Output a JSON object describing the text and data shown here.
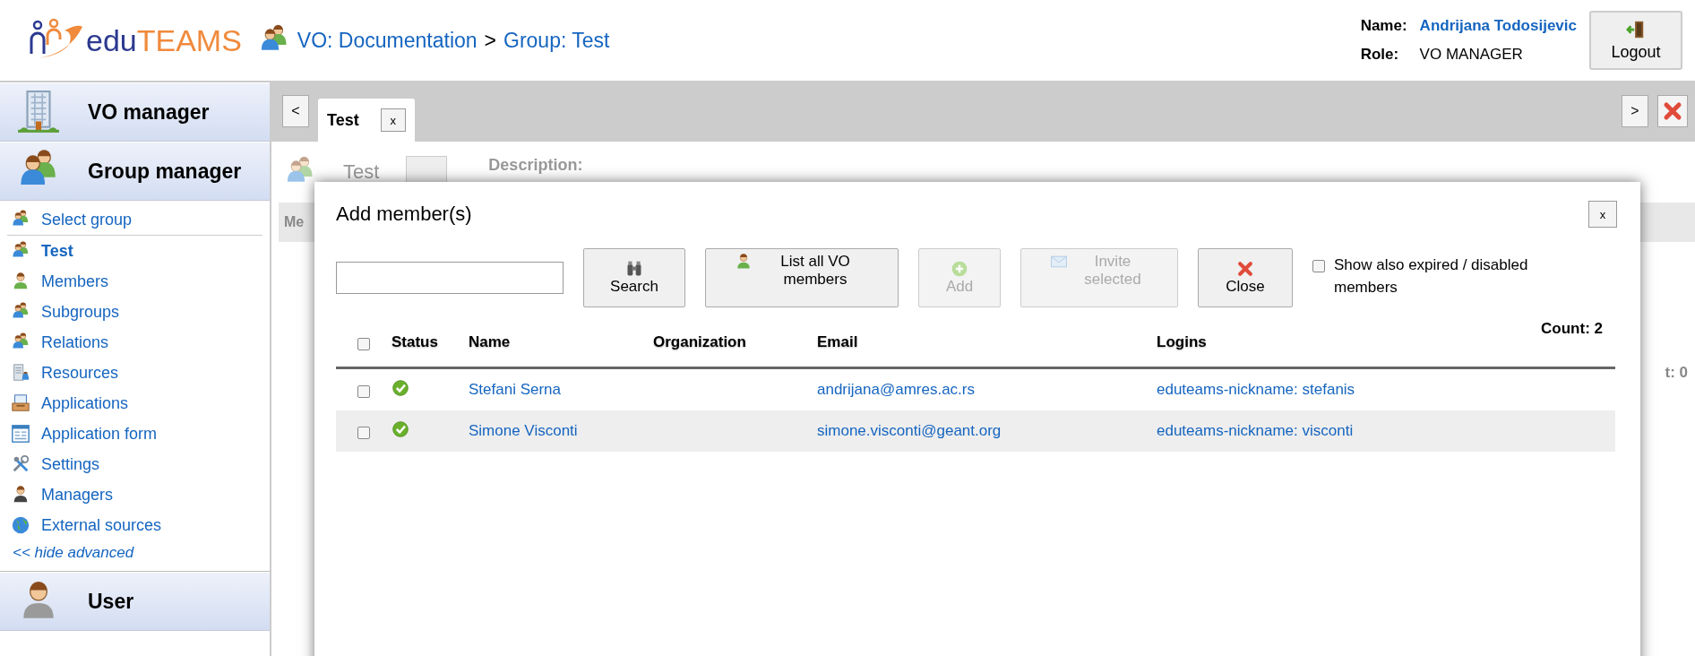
{
  "header": {
    "logo": {
      "part1": "edu",
      "part2": "TEAMS"
    },
    "breadcrumb": [
      {
        "kind": "link",
        "text": "VO: Documentation"
      },
      {
        "kind": "separator",
        "text": ">"
      },
      {
        "kind": "link",
        "text": "Group: Test"
      }
    ],
    "user": {
      "name_label": "Name:",
      "name": "Andrijana Todosijevic",
      "role_label": "Role:",
      "role": "VO MANAGER"
    },
    "logout": "Logout"
  },
  "sidebar": {
    "sections": [
      {
        "title": "VO manager"
      },
      {
        "title": "Group manager",
        "items": [
          {
            "label": "Select group",
            "selected": false
          },
          {
            "label": "Test",
            "selected": true
          },
          {
            "label": "Members",
            "selected": false
          },
          {
            "label": "Subgroups",
            "selected": false
          },
          {
            "label": "Relations",
            "selected": false
          },
          {
            "label": "Resources",
            "selected": false
          },
          {
            "label": "Applications",
            "selected": false
          },
          {
            "label": "Application form",
            "selected": false
          },
          {
            "label": "Settings",
            "selected": false
          },
          {
            "label": "Managers",
            "selected": false
          },
          {
            "label": "External sources",
            "selected": false
          }
        ],
        "toggle": "<< hide advanced"
      },
      {
        "title": "User"
      }
    ]
  },
  "tabbar": {
    "prev": "<",
    "next": ">",
    "tabs": [
      {
        "label": "Test",
        "close": "x",
        "selected": true
      }
    ]
  },
  "background": {
    "title": "Test",
    "description_label": "Description:",
    "subtab": "Me",
    "count": "t: 0"
  },
  "dialog": {
    "title": "Add member(s)",
    "close": "x",
    "buttons": [
      {
        "label": "Search",
        "disabled": false
      },
      {
        "label": "List all VO members",
        "disabled": false
      },
      {
        "label": "Add",
        "disabled": true
      },
      {
        "label": "Invite selected",
        "disabled": true
      },
      {
        "label": "Close",
        "disabled": false
      }
    ],
    "option": {
      "label": "Show also expired / disabled members",
      "checked": false
    },
    "table": {
      "select_all": false,
      "columns": [
        "Status",
        "Name",
        "Organization",
        "Email",
        "Logins"
      ],
      "count": "Count: 2",
      "rows": [
        {
          "checked": false,
          "valid": true,
          "name": "Stefani Serna",
          "email": "andrijana@amres.ac.rs",
          "logins": "eduteams-nickname: stefanis"
        },
        {
          "checked": false,
          "valid": true,
          "name": "Simone Visconti",
          "email": "simone.visconti@geant.org",
          "logins": "eduteams-nickname: visconti"
        }
      ]
    }
  }
}
